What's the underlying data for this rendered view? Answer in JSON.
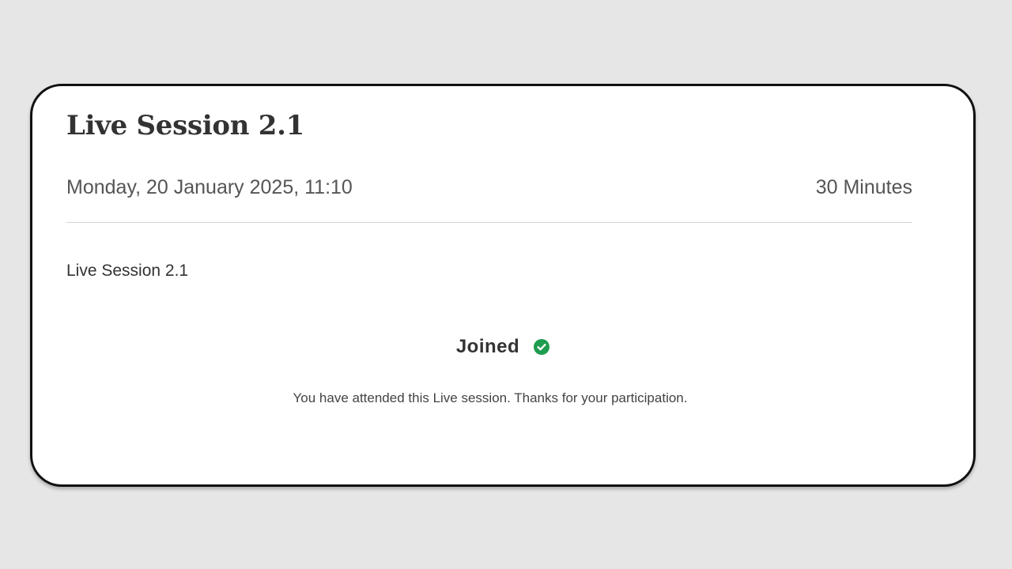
{
  "session": {
    "title": "Live Session 2.1",
    "datetime": "Monday, 20 January 2025, 11:10",
    "duration": "30 Minutes",
    "description": "Live Session 2.1",
    "status": {
      "label": "Joined",
      "icon": "check-circle-icon",
      "icon_color": "#1e9c4f",
      "message": "You have attended this Live session. Thanks for your participation."
    }
  },
  "colors": {
    "page_background": "#e6e6e6",
    "card_background": "#ffffff",
    "card_border": "#111111",
    "text_primary": "#333333",
    "text_secondary": "#555555"
  }
}
